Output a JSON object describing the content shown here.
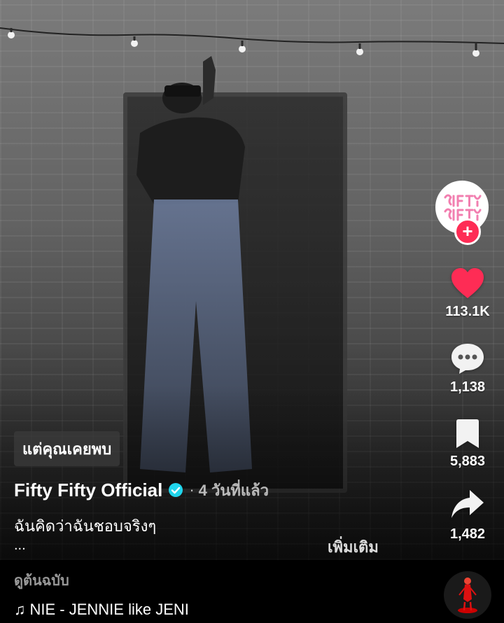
{
  "video": {
    "description_chip": "แต่คุณเคยพบ"
  },
  "author": {
    "name": "Fifty Fifty Official",
    "verified": true,
    "separator": "·",
    "time_ago": "4 วันที่แล้ว"
  },
  "post": {
    "caption": "ฉันคิดว่าฉันชอบจริงๆ",
    "ellipsis": "...",
    "more_label": "เพิ่มเติม"
  },
  "actions": {
    "like_count": "113.1K",
    "comment_count": "1,138",
    "save_count": "5,883",
    "share_count": "1,482"
  },
  "music": {
    "original_label": "ดูต้นฉบับ",
    "track": "NIE - JENNIE    like JENI"
  },
  "colors": {
    "like": "#fe2c55",
    "follow": "#fe2c55",
    "verified": "#20d5ec"
  },
  "icons": {
    "follow": "plus-icon",
    "like": "heart-icon",
    "comment": "comment-icon",
    "save": "bookmark-icon",
    "share": "share-arrow-icon",
    "music": "music-note-icon"
  }
}
